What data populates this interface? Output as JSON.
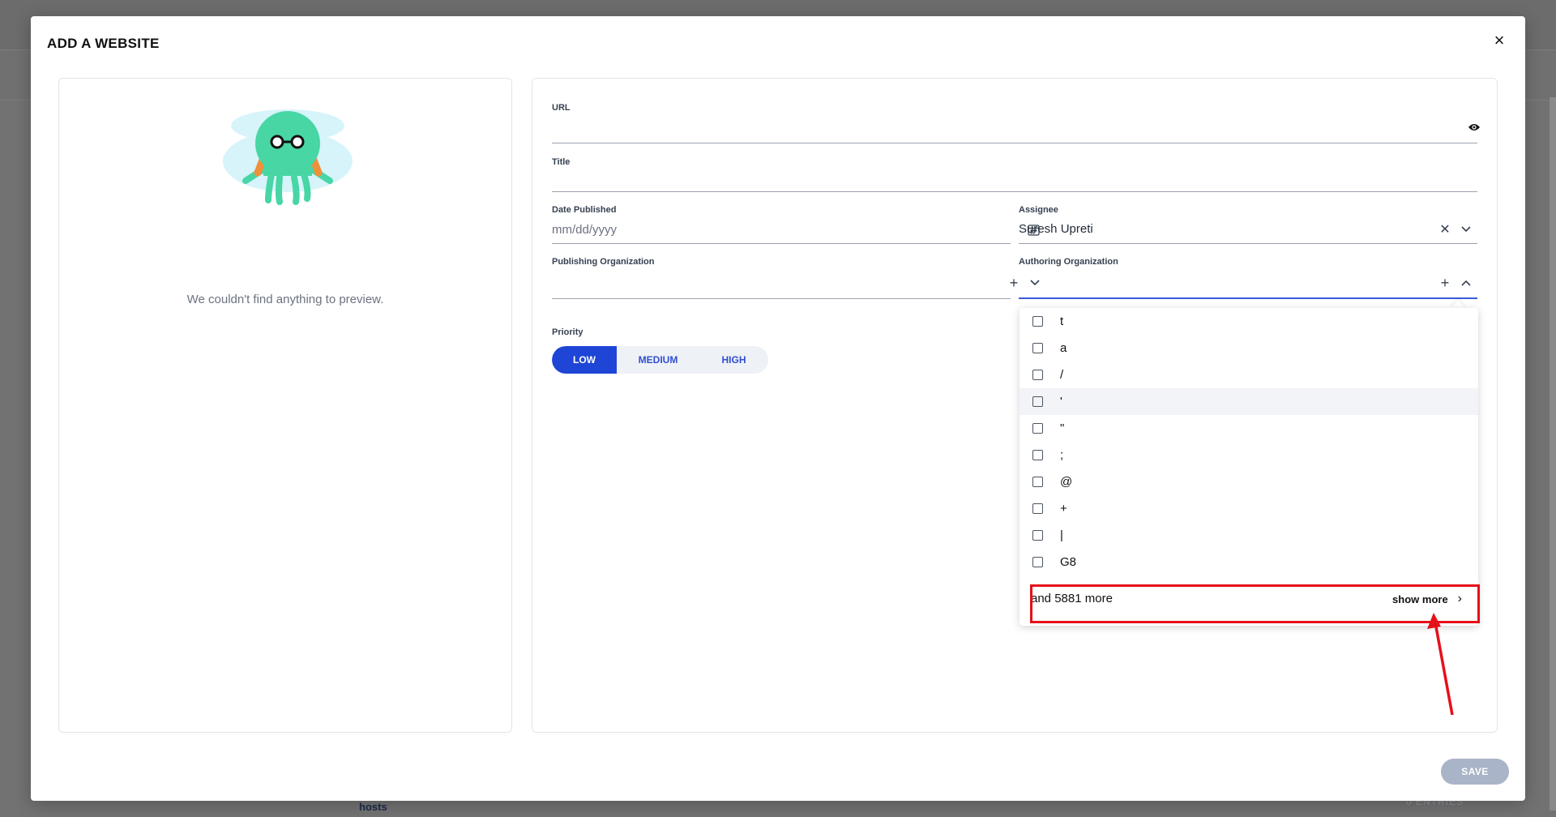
{
  "background": {
    "hosts_label": "hosts",
    "entries_label": "0 ENTRIES"
  },
  "modal": {
    "title": "ADD A WEBSITE",
    "close_icon": "close-icon"
  },
  "preview": {
    "empty_message": "We couldn't find anything to preview."
  },
  "form": {
    "url": {
      "label": "URL",
      "value": ""
    },
    "title": {
      "label": "Title",
      "value": ""
    },
    "date_published": {
      "label": "Date Published",
      "placeholder": "mm/dd/yyyy"
    },
    "assignee": {
      "label": "Assignee",
      "value": "Suresh Upreti"
    },
    "publishing_org": {
      "label": "Publishing Organization",
      "value": ""
    },
    "authoring_org": {
      "label": "Authoring Organization",
      "value": ""
    },
    "priority": {
      "label": "Priority",
      "options": [
        "LOW",
        "MEDIUM",
        "HIGH"
      ],
      "selected": "LOW"
    }
  },
  "dropdown": {
    "items": [
      "t",
      "a",
      "/",
      "'",
      "\"",
      ";",
      "@",
      "+",
      "|",
      "G8"
    ],
    "more_text": "and 5881 more",
    "show_more_label": "show more"
  },
  "actions": {
    "save_label": "SAVE"
  },
  "colors": {
    "accent": "#1f45d6",
    "annotation": "#e6101a"
  }
}
